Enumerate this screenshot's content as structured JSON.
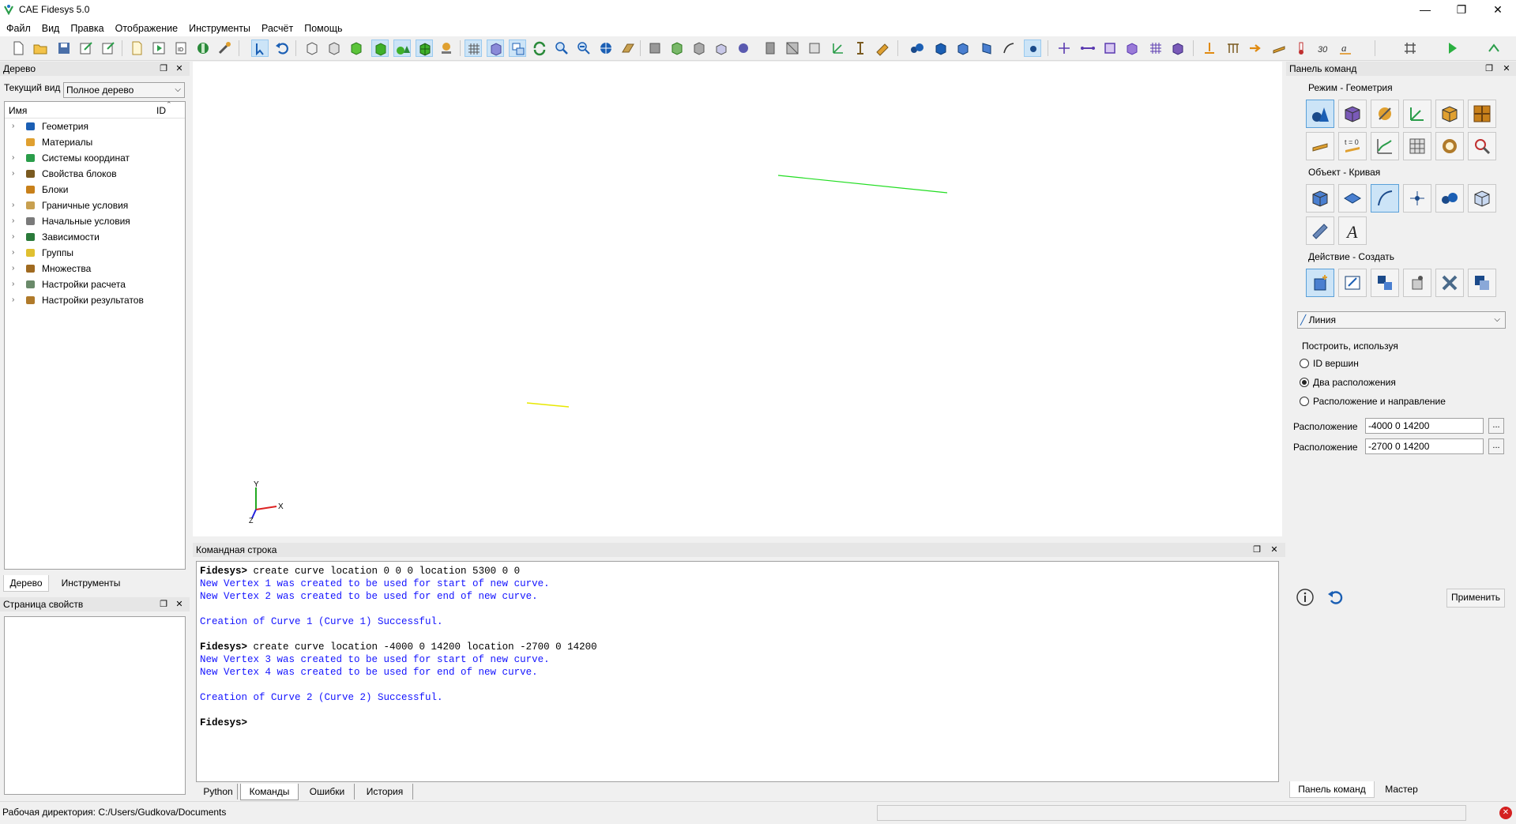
{
  "window": {
    "title": "CAE Fidesys 5.0",
    "minimize": "—",
    "restore": "❐",
    "close": "✕"
  },
  "menu": [
    "Файл",
    "Вид",
    "Правка",
    "Отображение",
    "Инструменты",
    "Расчёт",
    "Помощь"
  ],
  "tree_panel": {
    "title": "Дерево",
    "view_label": "Текущий вид",
    "view_value": "Полное дерево",
    "col_name": "Имя",
    "col_id": "ID",
    "items": [
      {
        "label": "Геометрия",
        "icon": "geometry-icon",
        "expandable": true
      },
      {
        "label": "Материалы",
        "icon": "materials-icon",
        "expandable": false
      },
      {
        "label": "Системы координат",
        "icon": "coordinate-systems-icon",
        "expandable": true
      },
      {
        "label": "Свойства блоков",
        "icon": "block-properties-icon",
        "expandable": true
      },
      {
        "label": "Блоки",
        "icon": "blocks-icon",
        "expandable": false
      },
      {
        "label": "Граничные условия",
        "icon": "boundary-conditions-icon",
        "expandable": true
      },
      {
        "label": "Начальные условия",
        "icon": "initial-conditions-icon",
        "expandable": true
      },
      {
        "label": "Зависимости",
        "icon": "dependencies-icon",
        "expandable": true
      },
      {
        "label": "Группы",
        "icon": "groups-icon",
        "expandable": true
      },
      {
        "label": "Множества",
        "icon": "sets-icon",
        "expandable": true
      },
      {
        "label": "Настройки расчета",
        "icon": "calc-settings-icon",
        "expandable": true
      },
      {
        "label": "Настройки результатов",
        "icon": "result-settings-icon",
        "expandable": true
      }
    ],
    "tabs": [
      "Дерево",
      "Инструменты"
    ]
  },
  "properties_panel": {
    "title": "Страница свойств"
  },
  "viewport": {
    "axis_x": "X",
    "axis_y": "Y",
    "axis_z": "Z"
  },
  "console": {
    "title": "Командная строка",
    "lines": [
      {
        "kind": "cmd",
        "prompt": "Fidesys>",
        "text": " create curve location 0 0 0 location 5300 0 0"
      },
      {
        "kind": "info",
        "text": "New Vertex 1 was created to be used for start of new curve."
      },
      {
        "kind": "info",
        "text": "New Vertex 2 was created to be used for end of new curve."
      },
      {
        "kind": "blank",
        "text": ""
      },
      {
        "kind": "info",
        "text": "Creation of Curve 1 (Curve 1) Successful."
      },
      {
        "kind": "blank",
        "text": ""
      },
      {
        "kind": "cmd",
        "prompt": "Fidesys>",
        "text": " create curve location -4000 0 14200 location -2700 0 14200"
      },
      {
        "kind": "info",
        "text": "New Vertex 3 was created to be used for start of new curve."
      },
      {
        "kind": "info",
        "text": "New Vertex 4 was created to be used for end of new curve."
      },
      {
        "kind": "blank",
        "text": ""
      },
      {
        "kind": "info",
        "text": "Creation of Curve 2 (Curve 2) Successful."
      },
      {
        "kind": "blank",
        "text": ""
      },
      {
        "kind": "cmd",
        "prompt": "Fidesys>",
        "text": ""
      }
    ],
    "tabs": [
      "Python",
      "Команды",
      "Ошибки",
      "История"
    ],
    "active_tab": "Команды"
  },
  "command_panel": {
    "title": "Панель команд",
    "mode_label": "Режим - Геометрия",
    "object_label": "Объект - Кривая",
    "action_label": "Действие - Создать",
    "type_value": "Линия",
    "build_label": "Построить, используя",
    "options": [
      {
        "label": "ID вершин",
        "selected": false
      },
      {
        "label": "Два расположения",
        "selected": true
      },
      {
        "label": "Расположение и направление",
        "selected": false
      }
    ],
    "location_label": "Расположение",
    "location1": "-4000 0 14200",
    "location2": "-2700 0 14200",
    "dots": "...",
    "apply": "Применить",
    "t0_label": "t = 0",
    "tabs": [
      "Панель команд",
      "Мастер"
    ]
  },
  "status": {
    "text": "Рабочая директория: C:/Users/Gudkova/Documents"
  },
  "colors": {
    "curve1": "#22dd22",
    "curve2": "#e8e800",
    "accent": "#0078d7",
    "info_text": "#1414ff"
  }
}
